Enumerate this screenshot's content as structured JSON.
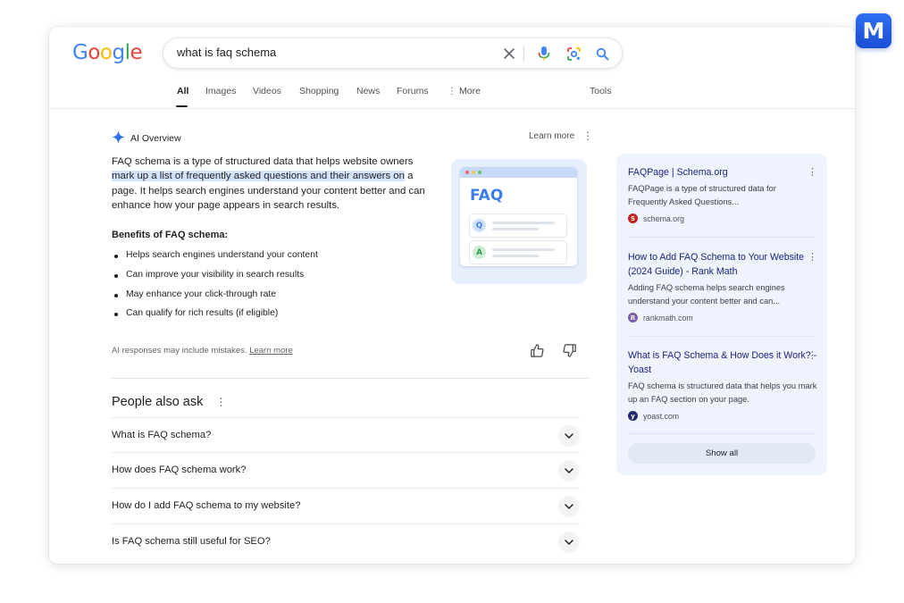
{
  "brand": {
    "badge_letter": "M",
    "badge_color": "#1a4fd6"
  },
  "logo": {
    "letters": [
      "G",
      "o",
      "o",
      "g",
      "l",
      "e"
    ],
    "colors": [
      "#4285F4",
      "#EA4335",
      "#FBBC05",
      "#4285F4",
      "#34A853",
      "#EA4335"
    ]
  },
  "search": {
    "query": "what is faq schema",
    "clear_icon": "close-icon",
    "voice_icon": "mic-icon",
    "lens_icon": "lens-icon",
    "search_icon": "search-icon"
  },
  "tabs": [
    {
      "label": "All",
      "active": true
    },
    {
      "label": "Images"
    },
    {
      "label": "Videos"
    },
    {
      "label": "Shopping"
    },
    {
      "label": "News"
    },
    {
      "label": "Forums"
    },
    {
      "label": "More"
    }
  ],
  "tools_label": "Tools",
  "ai_overview": {
    "label": "AI Overview",
    "learn_more": "Learn more",
    "summary_part1": "FAQ schema is a type of structured data that helps website owners ",
    "summary_highlight": "mark up a list of frequently asked questions and their answers on",
    "summary_part2": " a page. It helps search engines understand your content better and can enhance how your page appears in search results.",
    "benefits_title": "Benefits of FAQ schema:",
    "benefits": [
      "Helps search engines understand your content",
      "Can improve your visibility in search results",
      "May enhance your click-through rate",
      "Can qualify for rich results (if eligible)"
    ],
    "illustration": {
      "title": "FAQ",
      "q_label": "Q",
      "a_label": "A"
    },
    "disclaimer": "AI responses may include mistakes.",
    "disclaimer_link": "Learn more"
  },
  "people_also_ask": {
    "title": "People also ask",
    "questions": [
      "What is FAQ schema?",
      "How does FAQ schema work?",
      "How do I add FAQ schema to my website?",
      "Is FAQ schema still useful for SEO?"
    ]
  },
  "sources": {
    "items": [
      {
        "title": "FAQPage | Schema.org",
        "desc": "FAQPage is a type of structured data for Frequently Asked Questions...",
        "site": "schema.org",
        "fav_color": "#c5221f",
        "fav_glyph": "S"
      },
      {
        "title": "How to Add FAQ Schema to Your Website (2024 Guide) - Rank Math",
        "desc": "Adding FAQ schema helps search engines understand your content better and can...",
        "site": "rankmath.com",
        "fav_color": "#7b5ea7",
        "fav_glyph": "R"
      },
      {
        "title": "What is FAQ Schema & How Does it Work? - Yoast",
        "desc": "FAQ schema is structured data that helps you mark up an FAQ section on your page.",
        "site": "yoast.com",
        "fav_color": "#1f2a6b",
        "fav_glyph": "y"
      }
    ],
    "show_all": "Show all"
  }
}
